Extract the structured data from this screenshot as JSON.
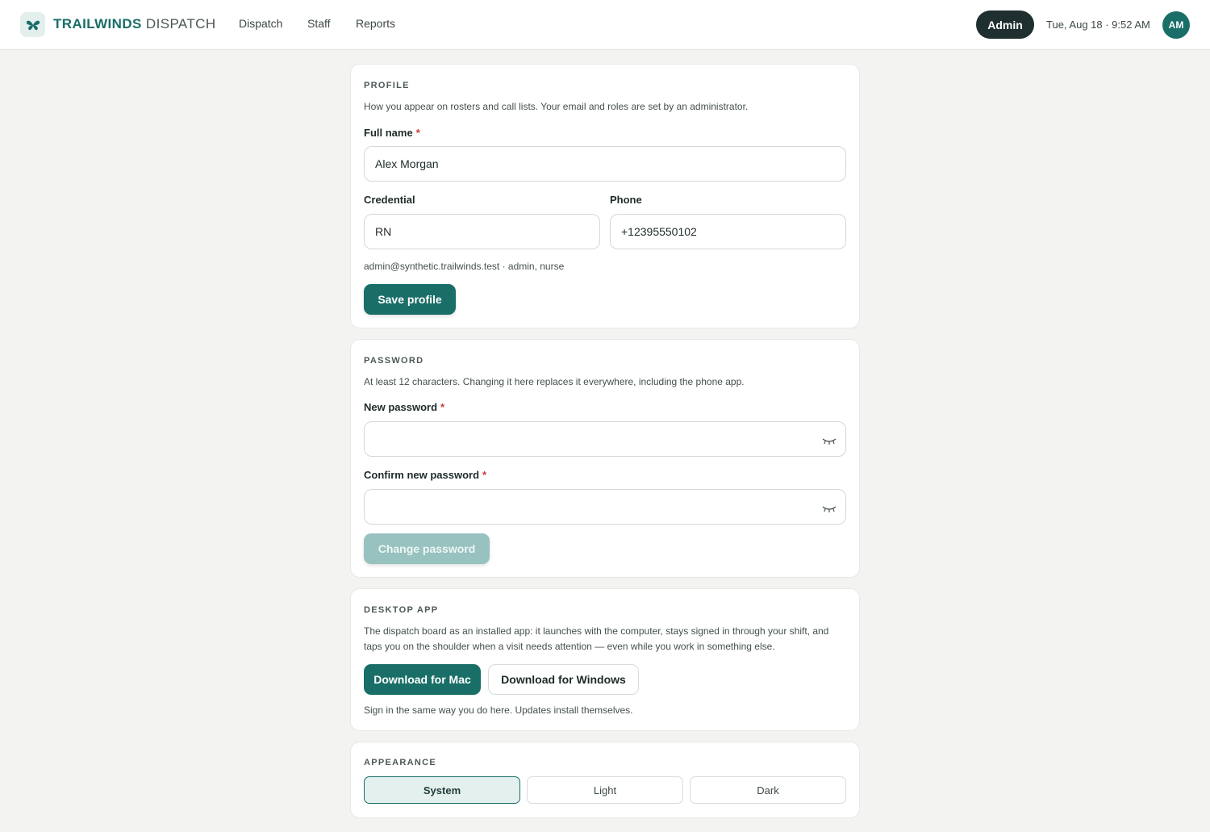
{
  "header": {
    "brand_bold": "TRAILWINDS",
    "brand_light": "DISPATCH",
    "nav": [
      "Dispatch",
      "Staff",
      "Reports"
    ],
    "role_badge": "Admin",
    "datetime": "Tue, Aug 18 · 9:52 AM",
    "avatar_initials": "AM"
  },
  "profile": {
    "title": "PROFILE",
    "description": "How you appear on rosters and call lists. Your email and roles are set by an administrator.",
    "full_name_label": "Full name",
    "full_name_value": "Alex Morgan",
    "credential_label": "Credential",
    "credential_value": "RN",
    "phone_label": "Phone",
    "phone_value": "+12395550102",
    "account_meta": "admin@synthetic.trailwinds.test · admin, nurse",
    "save_label": "Save profile"
  },
  "password": {
    "title": "PASSWORD",
    "description": "At least 12 characters. Changing it here replaces it everywhere, including the phone app.",
    "new_label": "New password",
    "new_value": "",
    "confirm_label": "Confirm new password",
    "confirm_value": "",
    "change_label": "Change password"
  },
  "desktop_app": {
    "title": "DESKTOP APP",
    "description_line1": "The dispatch board as an installed app: it launches with the computer, stays signed in through your shift, and",
    "description_line2": "taps you on the shoulder when a visit needs attention — even while you work in something else.",
    "mac_label": "Download for Mac",
    "windows_label": "Download for Windows",
    "note": "Sign in the same way you do here. Updates install themselves."
  },
  "appearance": {
    "title": "APPEARANCE",
    "options": [
      "System",
      "Light",
      "Dark"
    ],
    "selected": "System"
  },
  "required_marker": "*",
  "colors": {
    "accent": "#1a6e68",
    "accent_disabled": "#97c2bf",
    "required": "#c53b3b",
    "background": "#f3f3f2"
  },
  "icons": {
    "logo": "butterfly-icon",
    "password_toggle": "eye-closed-icon"
  }
}
